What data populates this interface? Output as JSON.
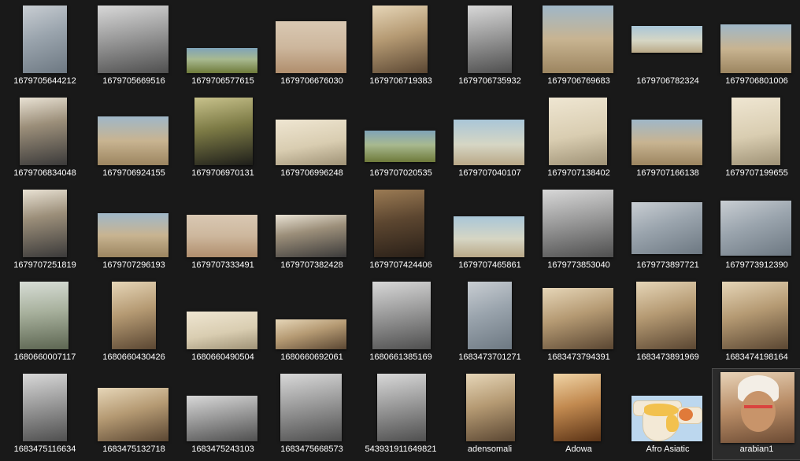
{
  "explorer": {
    "items": [
      {
        "label": "1679705644212",
        "tone": "bluegrey"
      },
      {
        "label": "1679705669516",
        "tone": "grey"
      },
      {
        "label": "1679706577615",
        "tone": "landscape"
      },
      {
        "label": "1679706676030",
        "tone": "beach"
      },
      {
        "label": "1679706719383",
        "tone": "sepia"
      },
      {
        "label": "1679706735932",
        "tone": "grey"
      },
      {
        "label": "1679706769683",
        "tone": "fort"
      },
      {
        "label": "1679706782324",
        "tone": "sky"
      },
      {
        "label": "1679706801006",
        "tone": "fort"
      },
      {
        "label": "1679706834048",
        "tone": "color"
      },
      {
        "label": "1679706924155",
        "tone": "fort"
      },
      {
        "label": "1679706970131",
        "tone": "olive"
      },
      {
        "label": "1679706996248",
        "tone": "paper"
      },
      {
        "label": "1679707020535",
        "tone": "landscape"
      },
      {
        "label": "1679707040107",
        "tone": "sky"
      },
      {
        "label": "1679707138402",
        "tone": "paper"
      },
      {
        "label": "1679707166138",
        "tone": "fort"
      },
      {
        "label": "1679707199655",
        "tone": "paper"
      },
      {
        "label": "1679707251819",
        "tone": "color"
      },
      {
        "label": "1679707296193",
        "tone": "fort"
      },
      {
        "label": "1679707333491",
        "tone": "beach"
      },
      {
        "label": "1679707382428",
        "tone": "color"
      },
      {
        "label": "1679707424406",
        "tone": "dark"
      },
      {
        "label": "1679707465861",
        "tone": "sky"
      },
      {
        "label": "1679773853040",
        "tone": "grey"
      },
      {
        "label": "1679773897721",
        "tone": "bluegrey"
      },
      {
        "label": "1679773912390",
        "tone": "bluegrey"
      },
      {
        "label": "1680660007117",
        "tone": "greygreen"
      },
      {
        "label": "1680660430426",
        "tone": "sepia"
      },
      {
        "label": "1680660490504",
        "tone": "paper"
      },
      {
        "label": "1680660692061",
        "tone": "sepia"
      },
      {
        "label": "1680661385169",
        "tone": "grey"
      },
      {
        "label": "1683473701271",
        "tone": "bluegrey"
      },
      {
        "label": "1683473794391",
        "tone": "sepia"
      },
      {
        "label": "1683473891969",
        "tone": "sepia"
      },
      {
        "label": "1683474198164",
        "tone": "sepia"
      },
      {
        "label": "1683475116634",
        "tone": "grey"
      },
      {
        "label": "1683475132718",
        "tone": "sepia"
      },
      {
        "label": "1683475243103",
        "tone": "grey"
      },
      {
        "label": "1683475668573",
        "tone": "grey"
      },
      {
        "label": "543931911649821",
        "tone": "grey"
      },
      {
        "label": "adensomali",
        "tone": "sepia"
      },
      {
        "label": "Adowa",
        "tone": "brown"
      },
      {
        "label": "Afro Asiatic",
        "tone": "map"
      },
      {
        "label": "arabian1",
        "tone": "face"
      }
    ],
    "selected_label": "arabian1",
    "colors": {
      "background": "#191919",
      "text": "#ffffff",
      "selection": "#2b2b2b"
    }
  }
}
